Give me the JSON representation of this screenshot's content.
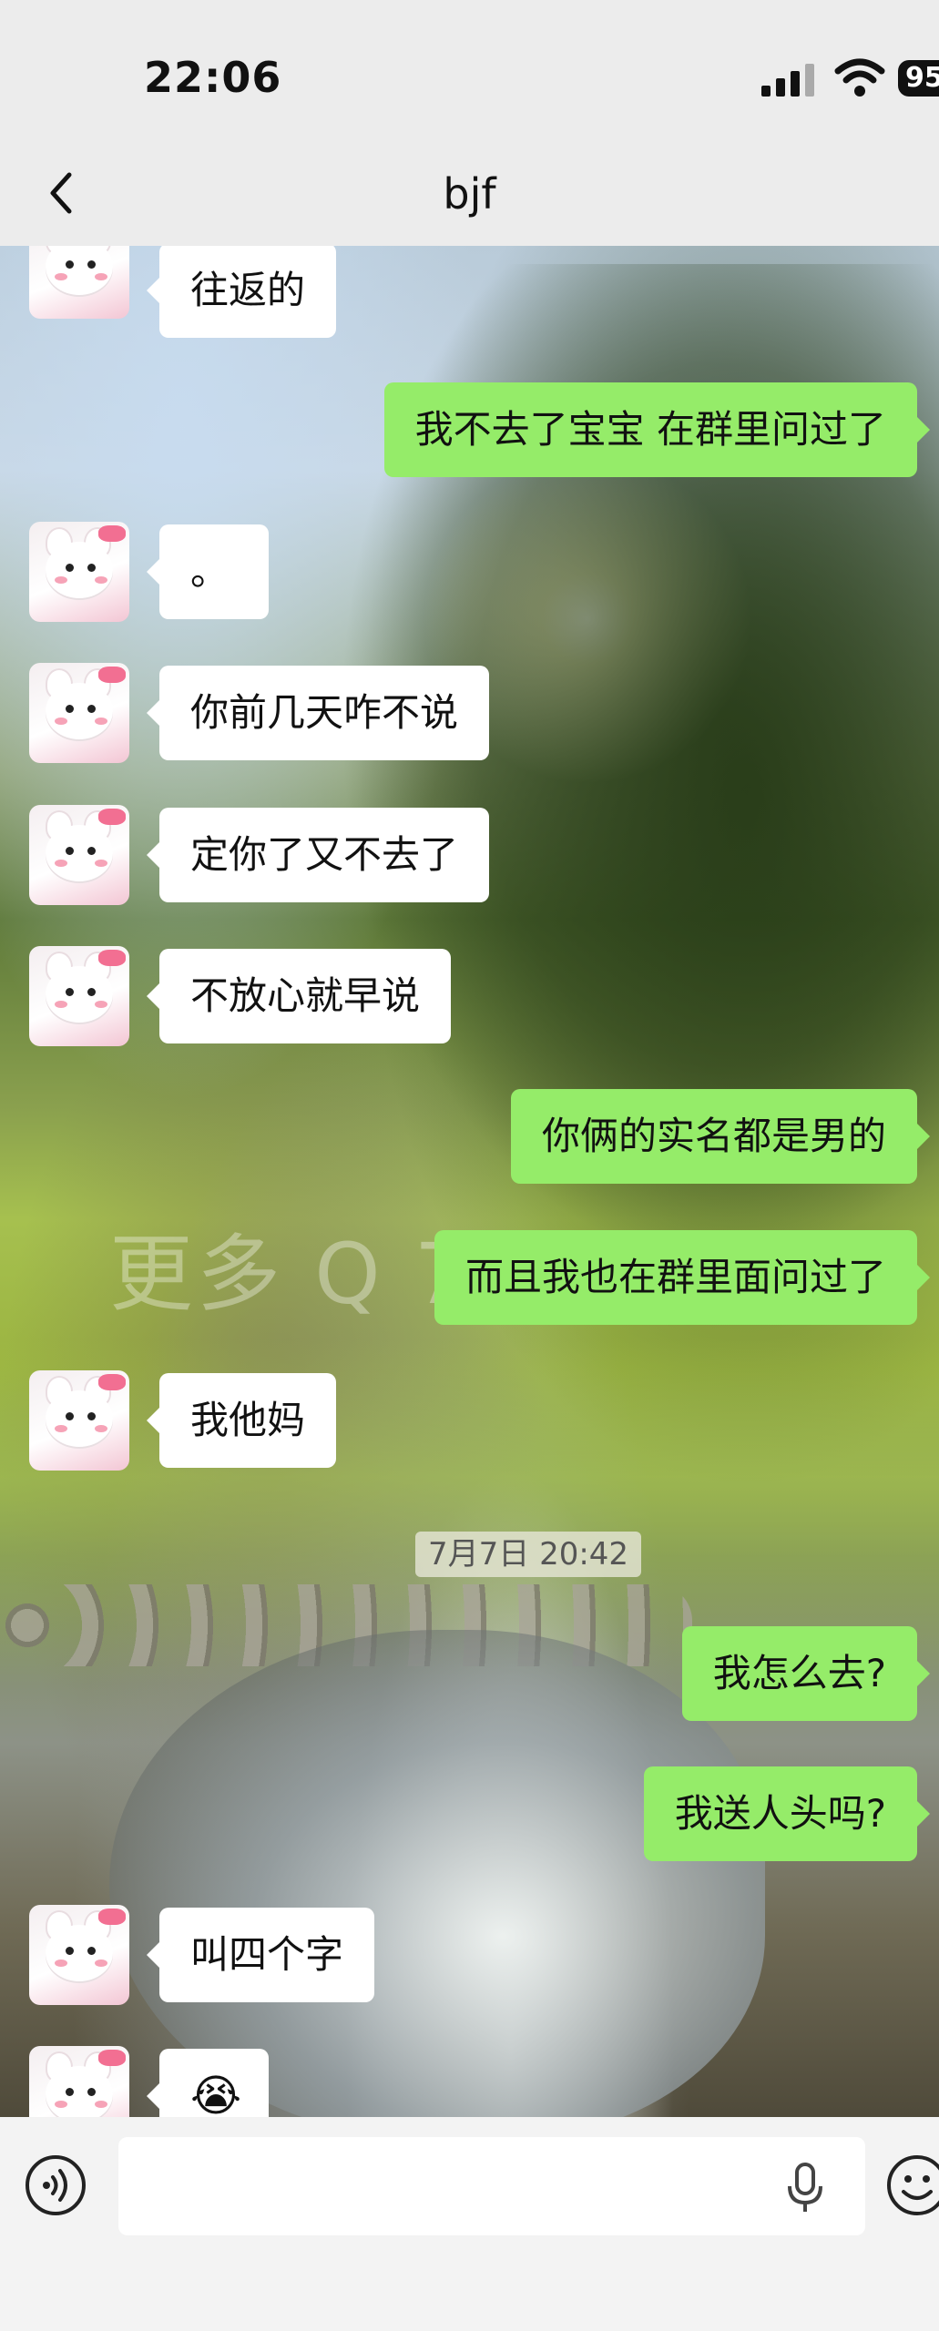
{
  "status_bar": {
    "time": "22:06",
    "battery": "95",
    "icons": [
      "signal-icon",
      "wifi-icon",
      "battery-icon"
    ]
  },
  "nav": {
    "title": "bjf",
    "back_icon": "chevron-left-icon"
  },
  "messages": [
    {
      "side": "left",
      "text": "往返的"
    },
    {
      "side": "right",
      "text": "我不去了宝宝 在群里问过了"
    },
    {
      "side": "left",
      "text": "。"
    },
    {
      "side": "left",
      "text": "你前几天咋不说"
    },
    {
      "side": "left",
      "text": "定你了又不去了"
    },
    {
      "side": "left",
      "text": "不放心就早说"
    },
    {
      "side": "right",
      "text": "你俩的实名都是男的"
    },
    {
      "side": "right",
      "text": "而且我也在群里面问过了"
    },
    {
      "side": "left",
      "text": "我他妈"
    },
    {
      "side": "right",
      "text": "我怎么去?"
    },
    {
      "side": "right",
      "text": "我送人头吗?"
    },
    {
      "side": "left",
      "text": "叫四个字"
    },
    {
      "side": "left",
      "text": "😭"
    }
  ],
  "timestamp": "7月7日 20:42",
  "watermark": "更多 Q 77cg.cn",
  "input_bar": {
    "voice_icon": "voice-mode-icon",
    "placeholder": "",
    "mic_icon": "microphone-icon",
    "emoji_icon": "emoji-icon"
  },
  "colors": {
    "sent_bubble": "#95ec69",
    "received_bubble": "#ffffff",
    "bar_background": "#ececec"
  }
}
